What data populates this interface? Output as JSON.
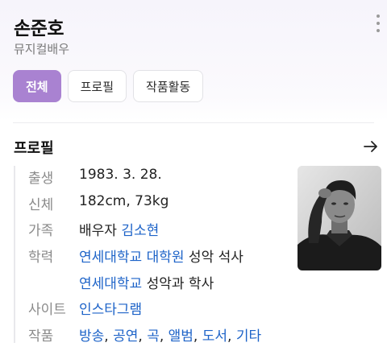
{
  "header": {
    "name": "손준호",
    "subtitle": "뮤지컬배우"
  },
  "tabs": [
    {
      "label": "전체",
      "active": true
    },
    {
      "label": "프로필",
      "active": false
    },
    {
      "label": "작품활동",
      "active": false
    }
  ],
  "section": {
    "title": "프로필"
  },
  "profile": {
    "birth": {
      "label": "출생",
      "value": "1983. 3. 28."
    },
    "body": {
      "label": "신체",
      "value": "182cm, 73kg"
    },
    "family": {
      "label": "가족",
      "prefix": "배우자 ",
      "link": "김소현"
    },
    "education": {
      "label": "학력",
      "line1_link": "연세대학교 대학원",
      "line1_text": " 성악 석사",
      "line2_link": "연세대학교",
      "line2_text": " 성악과 학사"
    },
    "site": {
      "label": "사이트",
      "link": "인스타그램"
    },
    "works": {
      "label": "작품",
      "items": [
        "방송",
        "공연",
        "곡",
        "앨범",
        "도서",
        "기타"
      ],
      "separator": ", "
    }
  },
  "colors": {
    "accent": "#a982d1",
    "link": "#1d63c8"
  },
  "icons": {
    "more": "more-vertical-icon",
    "arrow": "arrow-right-icon"
  }
}
